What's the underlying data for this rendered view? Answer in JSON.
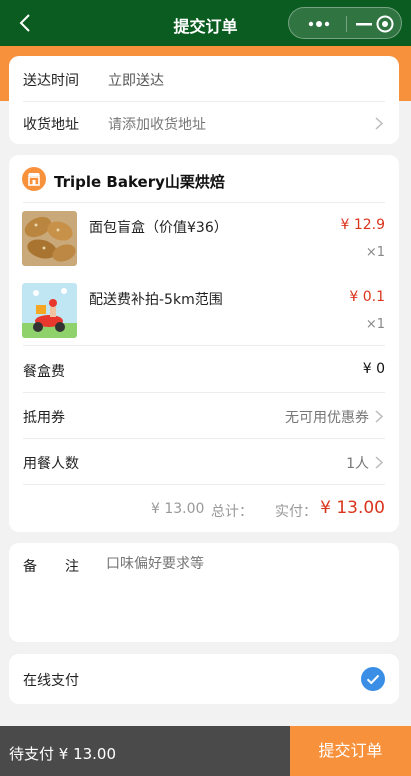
{
  "header": {
    "title": "提交订单",
    "back_icon": "chevron-left-icon",
    "more_icon": "more-dots-icon",
    "minimize_icon": "minimize-icon",
    "close_icon": "target-close-icon",
    "bg_color": "#0b5c20"
  },
  "delivery": {
    "time_label": "送达时间",
    "time_value": "立即送达",
    "address_label": "收货地址",
    "address_placeholder": "请添加收货地址"
  },
  "shop": {
    "icon": "shop-icon",
    "name": "Triple Bakery山栗烘焙"
  },
  "items": [
    {
      "name": "面包盲盒（价值¥36）",
      "price": "¥ 12.9",
      "qty": "×1",
      "thumb": "bread-image"
    },
    {
      "name": "配送费补拍-5km范围",
      "price": "¥ 0.1",
      "qty": "×1",
      "thumb": "delivery-scooter-image"
    }
  ],
  "fees": {
    "box_fee_label": "餐盒费",
    "box_fee_value": "¥ 0",
    "coupon_label": "抵用券",
    "coupon_value": "无可用优惠券",
    "diners_label": "用餐人数",
    "diners_value": "1人"
  },
  "totals": {
    "total_label": "总计：",
    "total_value": "¥ 13.00",
    "paid_label": "实付：",
    "paid_value": "¥ 13.00"
  },
  "remark": {
    "label": "备　　注",
    "placeholder": "口味偏好要求等"
  },
  "payment": {
    "label": "在线支付",
    "check_icon": "check-circle-icon"
  },
  "footer": {
    "pending": "待支付 ¥ 13.00",
    "submit": "提交订单"
  },
  "colors": {
    "accent_orange": "#f7913c",
    "price_red": "#d9341c",
    "check_blue": "#3a8ee6",
    "bar_dark": "#4a4a4a"
  }
}
